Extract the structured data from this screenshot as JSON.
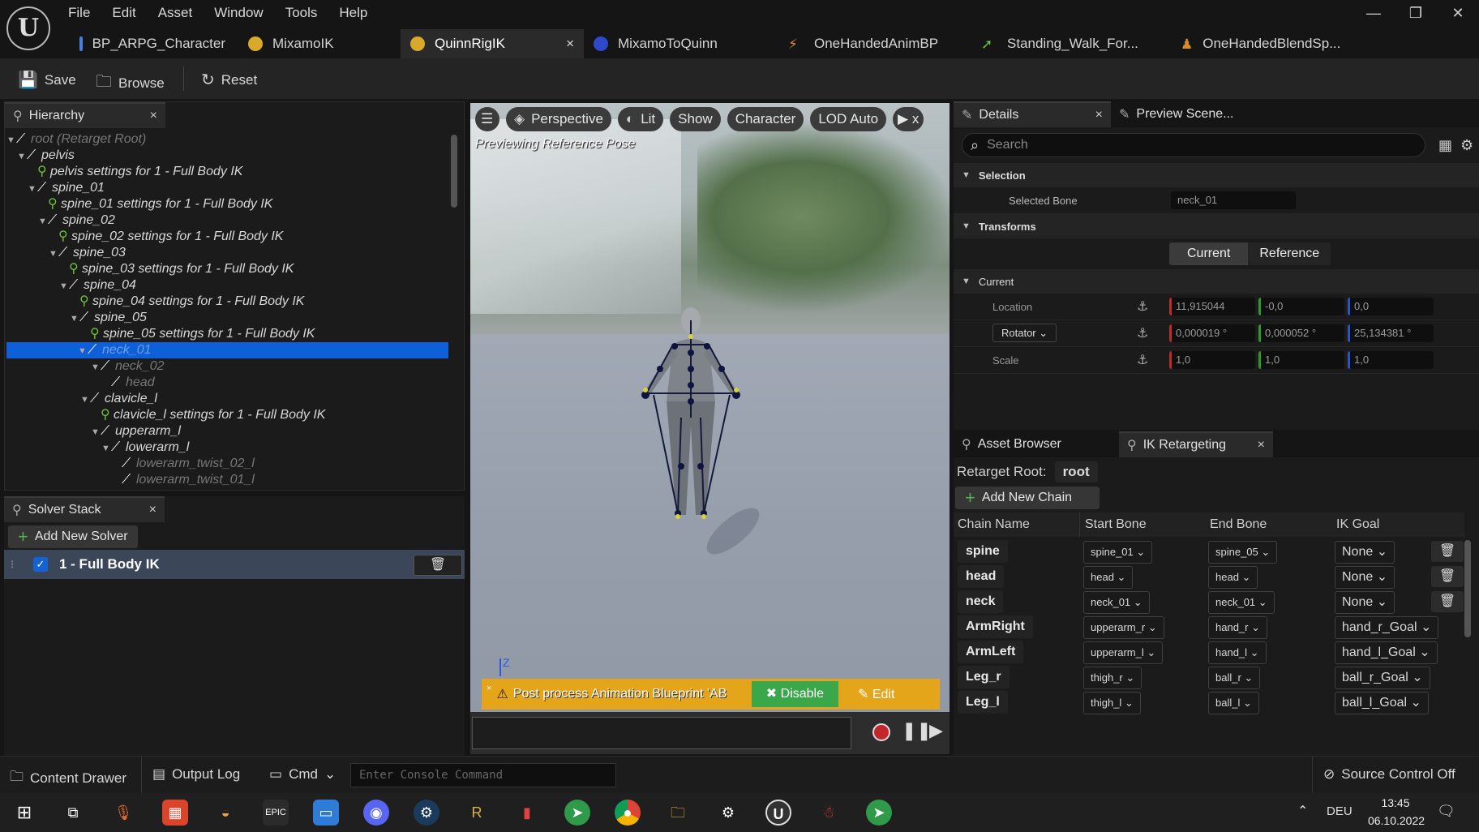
{
  "menu": [
    "File",
    "Edit",
    "Asset",
    "Window",
    "Tools",
    "Help"
  ],
  "window_controls": {
    "minimize": "—",
    "restore": "❐",
    "close": "✕"
  },
  "tabs": [
    {
      "label": "BP_ARPG_Character",
      "color": "#4a7fe0"
    },
    {
      "label": "MixamoIK",
      "color": "#d9a92a"
    },
    {
      "label": "QuinnRigIK",
      "color": "#d9a92a",
      "close": "×"
    },
    {
      "label": "MixamoToQuinn",
      "color": "#2e49c9"
    },
    {
      "label": "OneHandedAnimBP",
      "color": "#d98b2a"
    },
    {
      "label": "Standing_Walk_For...",
      "color": "#6bc235"
    },
    {
      "label": "OneHandedBlendSp...",
      "color": "#d98b2a"
    }
  ],
  "toolbar": {
    "save": "Save",
    "browse": "Browse",
    "reset": "Reset"
  },
  "hierarchy": {
    "title": "Hierarchy",
    "close": "×",
    "rows": [
      {
        "label": "root (Retarget Root)",
        "indent": 0,
        "type": "bone",
        "arrow": "▼",
        "dim": true
      },
      {
        "label": "pelvis",
        "indent": 1,
        "type": "bone",
        "arrow": "▼"
      },
      {
        "label": "pelvis settings for 1 - Full Body IK",
        "indent": 2,
        "type": "goal",
        "arrow": ""
      },
      {
        "label": "spine_01",
        "indent": 2,
        "type": "bone",
        "arrow": "▼"
      },
      {
        "label": "spine_01 settings for 1 - Full Body IK",
        "indent": 3,
        "type": "goal",
        "arrow": ""
      },
      {
        "label": "spine_02",
        "indent": 3,
        "type": "bone",
        "arrow": "▼"
      },
      {
        "label": "spine_02 settings for 1 - Full Body IK",
        "indent": 4,
        "type": "goal",
        "arrow": ""
      },
      {
        "label": "spine_03",
        "indent": 4,
        "type": "bone",
        "arrow": "▼"
      },
      {
        "label": "spine_03 settings for 1 - Full Body IK",
        "indent": 5,
        "type": "goal",
        "arrow": ""
      },
      {
        "label": "spine_04",
        "indent": 5,
        "type": "bone",
        "arrow": "▼"
      },
      {
        "label": "spine_04 settings for 1 - Full Body IK",
        "indent": 6,
        "type": "goal",
        "arrow": ""
      },
      {
        "label": "spine_05",
        "indent": 6,
        "type": "bone",
        "arrow": "▼"
      },
      {
        "label": "spine_05 settings for 1 - Full Body IK",
        "indent": 7,
        "type": "goal",
        "arrow": ""
      },
      {
        "label": "neck_01",
        "indent": 7,
        "type": "bone",
        "arrow": "▼",
        "selected": true
      },
      {
        "label": "neck_02",
        "indent": 8,
        "type": "bone",
        "arrow": "▼",
        "dim": true
      },
      {
        "label": "head",
        "indent": 9,
        "type": "bone",
        "arrow": "",
        "dim": true
      },
      {
        "label": "clavicle_l",
        "indent": 7,
        "type": "bone",
        "arrow": "▼"
      },
      {
        "label": "clavicle_l settings for 1 - Full Body IK",
        "indent": 8,
        "type": "goal",
        "arrow": ""
      },
      {
        "label": "upperarm_l",
        "indent": 8,
        "type": "bone",
        "arrow": "▼"
      },
      {
        "label": "lowerarm_l",
        "indent": 9,
        "type": "bone",
        "arrow": "▼"
      },
      {
        "label": "lowerarm_twist_02_l",
        "indent": 10,
        "type": "bone",
        "arrow": "",
        "dim": true
      },
      {
        "label": "lowerarm_twist_01_l",
        "indent": 10,
        "type": "bone",
        "arrow": "",
        "dim": true
      }
    ]
  },
  "solver": {
    "title": "Solver Stack",
    "close": "×",
    "add": "Add New Solver",
    "item": "1 - Full Body IK"
  },
  "viewport": {
    "buttons": [
      "Perspective",
      "Lit",
      "Show",
      "Character",
      "LOD Auto"
    ],
    "label": "Previewing Reference Pose",
    "warning": "Post process Animation Blueprint 'AB",
    "disable": "Disable",
    "edit": "Edit",
    "axis_label": "Z"
  },
  "details": {
    "tab": "Details",
    "close": "×",
    "tab2": "Preview Scene...",
    "search_placeholder": "Search",
    "selection": "Selection",
    "selected_bone_label": "Selected Bone",
    "selected_bone": "neck_01",
    "transforms": "Transforms",
    "current_btn": "Current",
    "reference_btn": "Reference",
    "current": "Current",
    "location": "Location",
    "location_vals": [
      "11,915044",
      "-0,0",
      "0,0"
    ],
    "rotator": "Rotator",
    "rotator_vals": [
      "0,000019 °",
      "0,000052 °",
      "25,134381 °"
    ],
    "scale": "Scale",
    "scale_vals": [
      "1,0",
      "1,0",
      "1,0"
    ]
  },
  "retarget": {
    "tab1": "Asset Browser",
    "tab2": "IK Retargeting",
    "close": "×",
    "root_label": "Retarget Root:",
    "root_value": "root",
    "add_chain": "Add New Chain",
    "headers": [
      "Chain Name",
      "Start Bone",
      "End Bone",
      "IK Goal"
    ],
    "chains": [
      {
        "name": "spine",
        "start": "spine_01",
        "end": "spine_05",
        "goal": "None",
        "trash": true
      },
      {
        "name": "head",
        "start": "head",
        "end": "head",
        "goal": "None",
        "trash": true
      },
      {
        "name": "neck",
        "start": "neck_01",
        "end": "neck_01",
        "goal": "None",
        "trash": true
      },
      {
        "name": "ArmRight",
        "start": "upperarm_r",
        "end": "hand_r",
        "goal": "hand_r_Goal",
        "trash": false
      },
      {
        "name": "ArmLeft",
        "start": "upperarm_l",
        "end": "hand_l",
        "goal": "hand_l_Goal",
        "trash": false
      },
      {
        "name": "Leg_r",
        "start": "thigh_r",
        "end": "ball_r",
        "goal": "ball_r_Goal",
        "trash": false
      },
      {
        "name": "Leg_l",
        "start": "thigh_l",
        "end": "ball_l",
        "goal": "ball_l_Goal",
        "trash": false
      }
    ]
  },
  "statusbar": {
    "content_drawer": "Content Drawer",
    "output_log": "Output Log",
    "cmd": "Cmd",
    "console_placeholder": "Enter Console Command",
    "source_control": "Source Control Off"
  },
  "taskbar": {
    "lang": "DEU",
    "time": "13:45",
    "date": "06.10.2022"
  }
}
